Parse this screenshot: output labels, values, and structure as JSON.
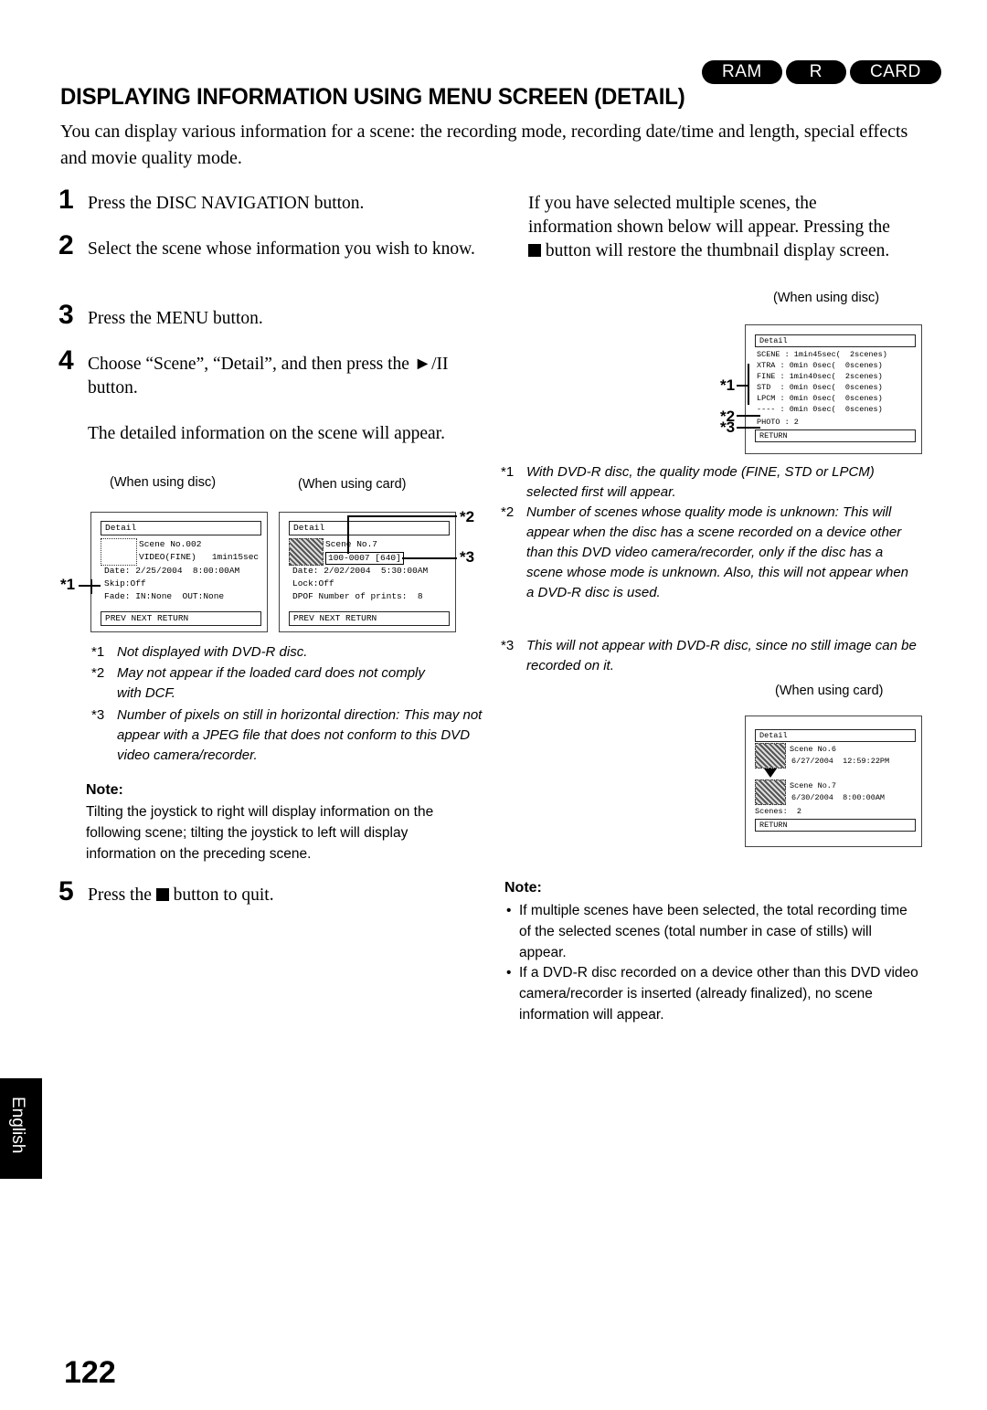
{
  "badges": [
    "RAM",
    "R",
    "CARD"
  ],
  "title": "DISPLAYING INFORMATION USING MENU SCREEN (DETAIL)",
  "intro": "You can display various information for a scene: the recording mode, recording date/time and length, special effects and movie quality mode.",
  "steps": [
    {
      "num": "1",
      "text": "Press the DISC NAVIGATION button."
    },
    {
      "num": "2",
      "text": "Select the scene whose information you wish to know."
    },
    {
      "num": "3",
      "text": "Press the MENU button."
    },
    {
      "num": "4",
      "text": "Choose “Scene”, “Detail”, and then press the ►/II button."
    },
    {
      "num": "5",
      "text_before": "Press the",
      "text_after": "button to quit."
    }
  ],
  "step4_result": "The detailed information on the scene will appear.",
  "left_screens": {
    "disc_caption": "(When using disc)",
    "card_caption": "(When using card)",
    "disc": {
      "title": "Detail",
      "lines": [
        "Scene No.002",
        "VIDEO(FINE)   1min15sec",
        "Date: 2/25/2004  8:00:00AM",
        "Skip:Off",
        "Fade: IN:None  OUT:None"
      ],
      "bottom": "PREV  NEXT  RETURN"
    },
    "card": {
      "title": "Detail",
      "lines": [
        "Scene No.7",
        "100-0007 [640]",
        "Date: 2/02/2004  5:30:00AM",
        "Lock:Off",
        "DPOF Number of prints:  8"
      ],
      "bottom": "PREV  NEXT  RETURN"
    },
    "callouts": [
      "*1",
      "*2",
      "*3"
    ]
  },
  "left_footnotes": [
    {
      "mark": "*1",
      "text": "Not displayed with DVD-R disc."
    },
    {
      "mark": "*2",
      "text": "May not appear if the loaded card does not comply with DCF."
    },
    {
      "mark": "*3",
      "text": "Number of pixels on still in horizontal direction: This may not appear with a JPEG file that does not conform to this DVD video camera/recorder."
    }
  ],
  "left_note": {
    "heading": "Note:",
    "text": "Tilting the joystick to right will display information on the following scene; tilting the joystick to left will display information on the preceding scene."
  },
  "right_intro": {
    "text_before": "If you have selected multiple scenes, the information shown below will appear. Pressing the",
    "text_after": "button will restore the thumbnail display screen."
  },
  "right_disc_screen": {
    "caption": "(When using disc)",
    "title": "Detail",
    "lines": [
      "XTRA : 0min 0sec(  0scenes)",
      "FINE : 1min40sec(  2scenes)",
      "STD  : 0min 0sec(  0scenes)",
      "LPCM : 0min 0sec(  0scenes)",
      "---- : 0min 0sec(  0scenes)",
      "PHOTO : 2"
    ],
    "header_line": "SCENE : 1min45sec(  2scenes)",
    "bottom": "RETURN",
    "callouts": [
      "*1",
      "*2",
      "*3"
    ]
  },
  "right_footnotes": [
    {
      "mark": "*1",
      "text": "With DVD-R disc, the quality mode (FINE, STD or LPCM) selected first will appear."
    },
    {
      "mark": "*2",
      "text": "Number of scenes whose quality mode is unknown: This will appear when the disc has a scene recorded on a device other than this DVD video camera/recorder, only if the disc has a scene whose mode is unknown. Also, this will not appear when a DVD-R disc is used."
    },
    {
      "mark": "*3",
      "text": "This will not appear with DVD-R disc, since no still image can be recorded on it."
    }
  ],
  "right_card_screen": {
    "caption": "(When using card)",
    "title": "Detail",
    "scene_a": {
      "label": "Scene No.6",
      "date": "6/27/2004  12:59:22PM"
    },
    "scene_b": {
      "label": "Scene No.7",
      "date": "6/30/2004  8:00:00AM"
    },
    "scenes_line": "Scenes:  2",
    "bottom": "RETURN"
  },
  "right_note": {
    "heading": "Note:",
    "bullets": [
      "If multiple scenes have been selected, the total recording time of the selected scenes (total number in case of stills) will appear.",
      "If a DVD-R disc recorded on a device other than this DVD video camera/recorder is inserted (already finalized), no scene information will appear."
    ]
  },
  "side_tab": "English",
  "page_number": "122"
}
